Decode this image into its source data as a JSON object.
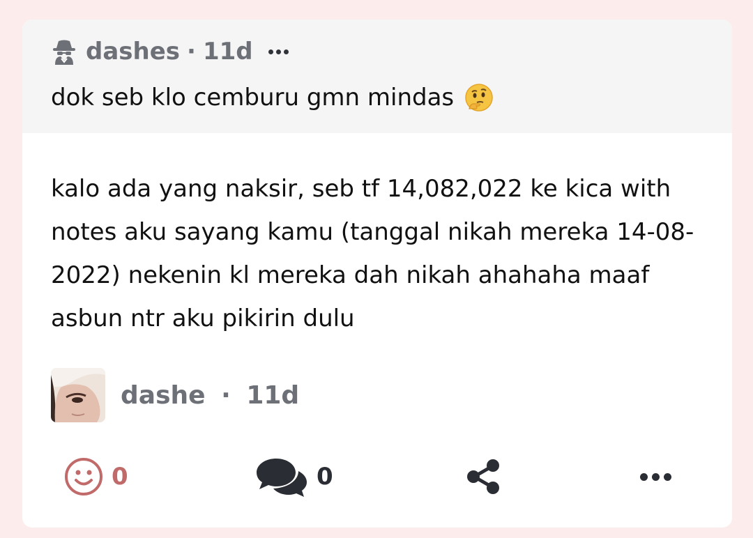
{
  "question": {
    "asker": "dashes",
    "separator": "·",
    "age": "11d",
    "text": "dok seb klo cemburu gmn mindas",
    "icons": {
      "asker": "spy-icon",
      "emoji": "thinking-face-emoji",
      "menu": "more-dots-icon"
    }
  },
  "answer": {
    "text": "kalo ada yang naksir, seb tf 14,082,022 ke kica with notes aku sayang kamu (tanggal nikah mereka 14-08-2022) nekenin kl mereka dah nikah ahahaha maaf asbun ntr aku pikirin dulu",
    "author": "dashe",
    "separator": "·",
    "age": "11d"
  },
  "actions": {
    "reactions": "0",
    "comments": "0",
    "icons": [
      "smiley-icon",
      "comments-icon",
      "share-icon",
      "more-dots-icon"
    ]
  },
  "colors": {
    "page_bg": "#fdecec",
    "question_bg": "#f5f5f5",
    "meta_text": "#6d7177",
    "reaction_accent": "#c06a6a"
  }
}
